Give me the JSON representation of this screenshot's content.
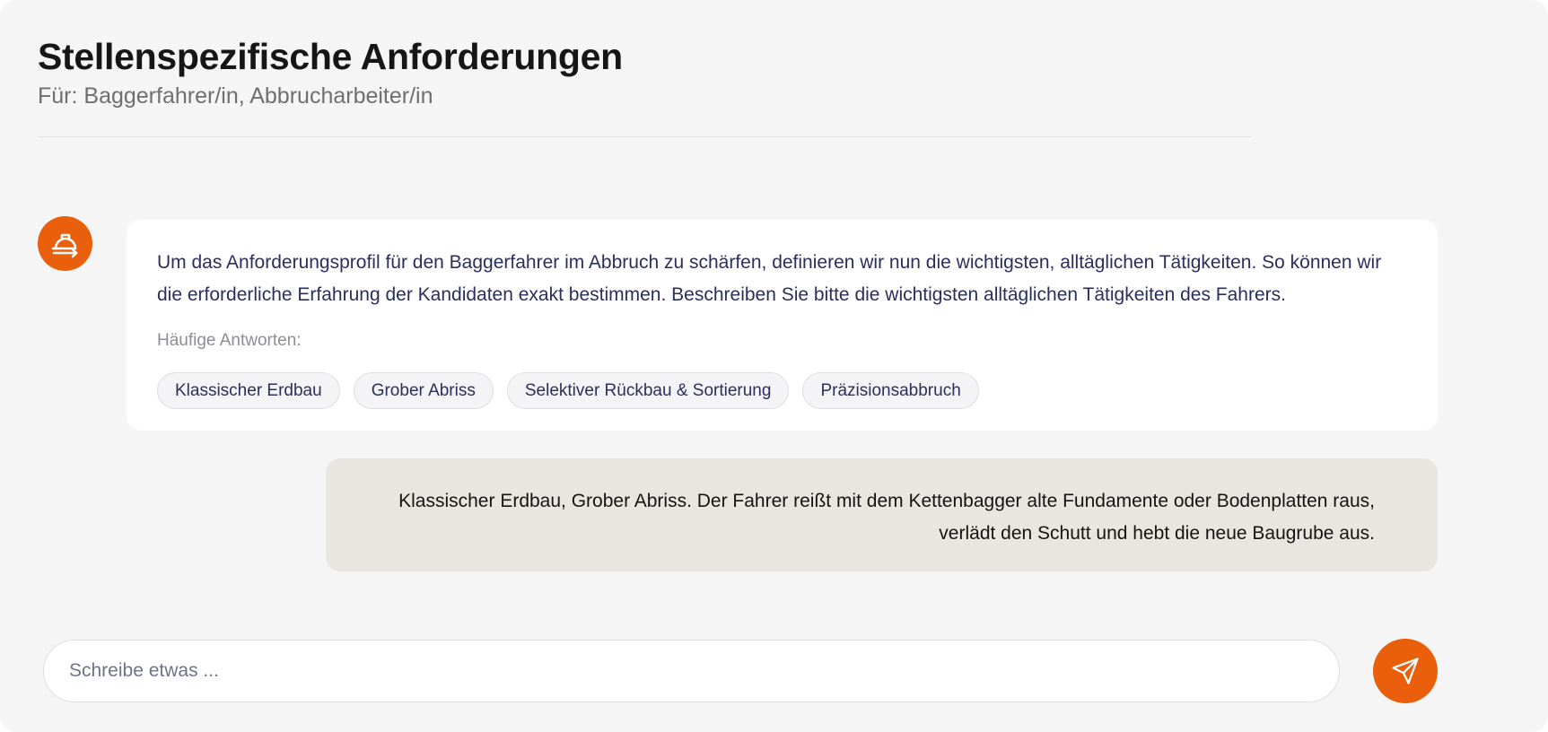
{
  "header": {
    "title": "Stellenspezifische Anforderungen",
    "subtitle": "Für: Baggerfahrer/in, Abbrucharbeiter/in"
  },
  "colors": {
    "accent": "#ea5f0b",
    "background": "#f5f5f5",
    "bot_bubble": "#ffffff",
    "user_bubble": "#e8e6e1",
    "bot_text": "#2a2f5c"
  },
  "chat": {
    "bot": {
      "avatar_icon": "hard-hat-icon",
      "message": "Um das Anforderungsprofil für den Baggerfahrer im Abbruch zu schärfen, definieren wir nun die wichtigsten, alltäglichen Tätigkeiten. So können wir die erforderliche Erfahrung der Kandidaten exakt bestimmen. Beschreiben Sie bitte die wichtigsten alltäglichen Tätigkeiten des Fahrers.",
      "suggestions_label": "Häufige Antworten:",
      "suggestions": [
        "Klassischer Erdbau",
        "Grober Abriss",
        "Selektiver Rückbau & Sortierung",
        "Präzisionsabbruch"
      ]
    },
    "user": {
      "message": "Klassischer Erdbau, Grober Abriss. Der Fahrer reißt mit dem Kettenbagger alte Fundamente oder Bodenplatten raus, verlädt den Schutt und hebt die neue Baugrube aus."
    }
  },
  "composer": {
    "placeholder": "Schreibe etwas ...",
    "value": "",
    "send_icon": "send-icon"
  }
}
